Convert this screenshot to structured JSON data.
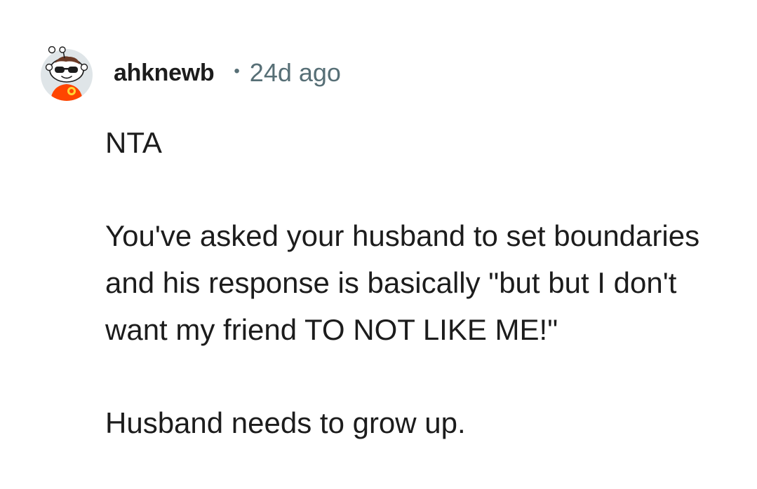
{
  "comment": {
    "author": "ahknewb",
    "separator": "•",
    "timestamp": "24d ago",
    "avatar_icon": "reddit-snoo-sunglasses-avatar",
    "paragraphs": [
      "NTA",
      "You've asked your husband to set boundaries and his response is basically \"but but I don't want my friend TO NOT LIKE ME!\"",
      "Husband needs to grow up."
    ]
  },
  "colors": {
    "text": "#1c1c1c",
    "meta": "#576f76",
    "avatar_bg": "#dfe5e8",
    "avatar_shirt": "#ff4500",
    "avatar_badge": "#ffd635"
  }
}
